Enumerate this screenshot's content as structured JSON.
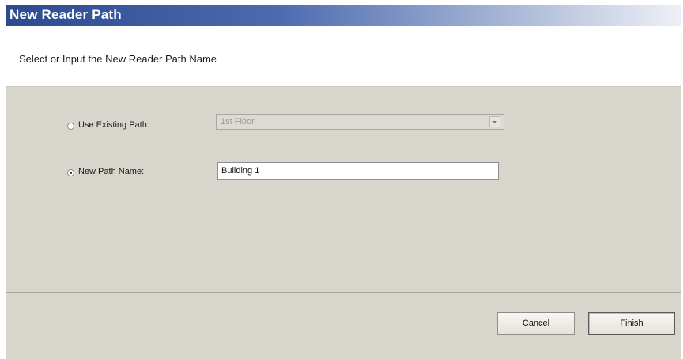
{
  "window": {
    "title": "New Reader Path"
  },
  "header": {
    "instruction": "Select or Input the New Reader Path Name"
  },
  "form": {
    "existing_path_label": "Use Existing Path:",
    "existing_path_selected": false,
    "existing_path_value": "1st Floor",
    "new_path_label": "New Path Name:",
    "new_path_selected": true,
    "new_path_value": "Building 1"
  },
  "footer": {
    "cancel_label": "Cancel",
    "finish_label": "Finish"
  }
}
